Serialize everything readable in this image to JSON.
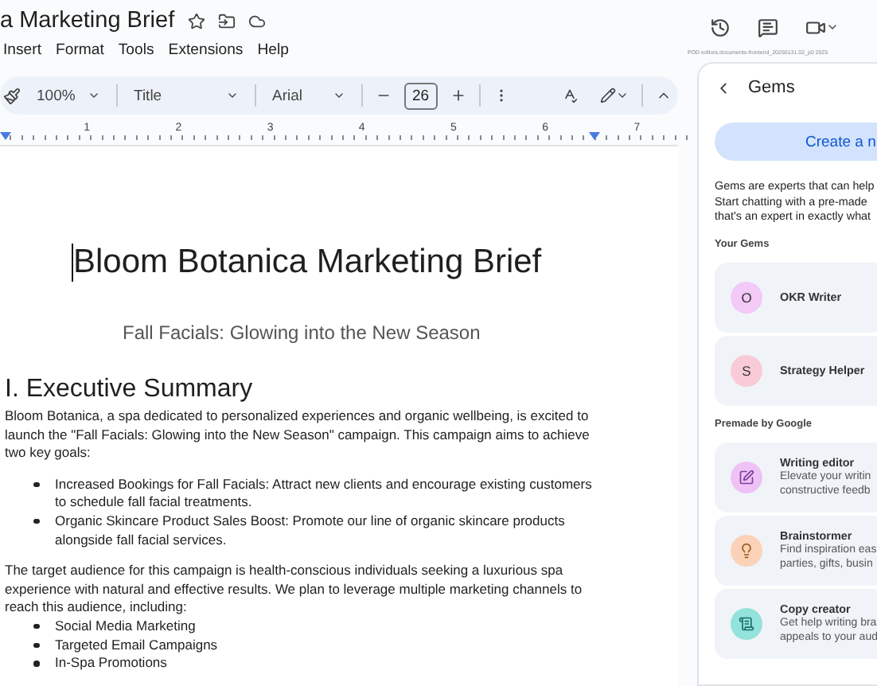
{
  "document_title": "a Marketing Brief",
  "menu": [
    "Insert",
    "Format",
    "Tools",
    "Extensions",
    "Help"
  ],
  "toolbar": {
    "zoom": "100%",
    "style": "Title",
    "font": "Arial",
    "font_size": "26"
  },
  "ruler": [
    "1",
    "2",
    "3",
    "4",
    "5",
    "6",
    "7"
  ],
  "build_label": "POD editors.documents-frontend_20250131.02_p0 2025",
  "document": {
    "title": "Bloom Botanica Marketing Brief",
    "subtitle": "Fall Facials: Glowing into the New Season",
    "heading": "I. Executive Summary",
    "intro": "Bloom Botanica, a spa dedicated to personalized experiences and organic wellbeing, is excited to launch the \"Fall Facials: Glowing into the New Season\" campaign. This campaign aims to achieve two key goals:",
    "goals": [
      "Increased Bookings for Fall Facials: Attract new clients and encourage existing customers to schedule fall facial treatments.",
      "Organic Skincare Product Sales Boost:  Promote our line of organic skincare products alongside fall facial services."
    ],
    "audience": "The target audience for this campaign is health-conscious individuals seeking a luxurious spa experience with natural and effective results. We plan to leverage multiple marketing channels to reach this audience, including:",
    "channels": [
      "Social Media Marketing",
      "Targeted Email Campaigns",
      "In-Spa Promotions"
    ]
  },
  "gems_panel": {
    "title": "Gems",
    "create_button": "Create a n",
    "description": [
      "Gems are experts that can help",
      "Start chatting with a pre-made",
      "that's an expert in exactly what"
    ],
    "your_gems_label": "Your Gems",
    "your_gems": [
      {
        "initial": "O",
        "name": "OKR Writer",
        "color": "#f2c9f7"
      },
      {
        "initial": "S",
        "name": "Strategy Helper",
        "color": "#f9cbd6"
      }
    ],
    "premade_label": "Premade by Google",
    "premade": [
      {
        "kind": "edit",
        "name": "Writing editor",
        "description": [
          "Elevate your writin",
          "constructive feedb"
        ],
        "color": "#efc2f6"
      },
      {
        "kind": "bulb",
        "name": "Brainstormer",
        "description": [
          "Find inspiration eas",
          "parties, gifts, busin"
        ],
        "color": "#fbd2b8"
      },
      {
        "kind": "doc",
        "name": "Copy creator",
        "description": [
          "Get help writing bra",
          "appeals to your aud"
        ],
        "color": "#93e2dc"
      }
    ]
  }
}
